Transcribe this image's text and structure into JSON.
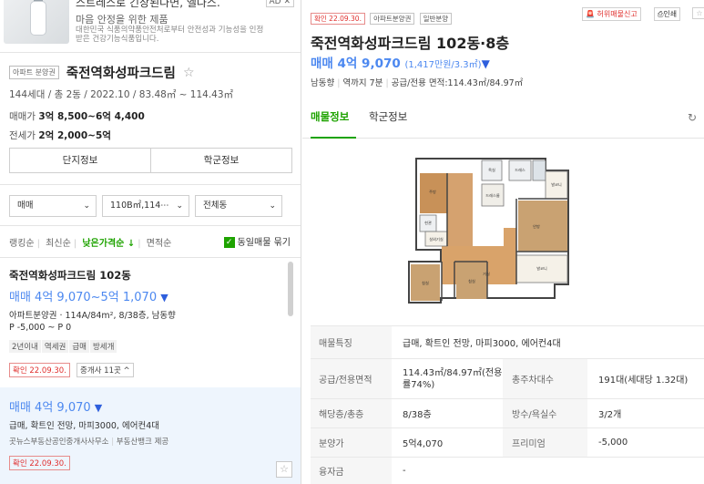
{
  "ad": {
    "title": "스트레스로 긴장된다면, 엘나스.",
    "subtitle": "마음 안정을 위한 제품",
    "desc": "대한민국 식품의약품안전처로부터 안전성과 기능성을 인정받은 건강기능식품입니다.",
    "badge": "AD ✕"
  },
  "complex": {
    "type_chip": "아파트 분양권",
    "name": "죽전역화성파크드림",
    "star": "☆",
    "meta": "144세대 / 총 2동 / 2022.10 / 83.48㎡ ~ 114.43㎡",
    "sale_label": "매매가",
    "sale_value": "3억 8,500~6억 4,400",
    "jeonse_label": "전세가",
    "jeonse_value": "2억 2,000~5억"
  },
  "segments": [
    "단지정보",
    "학군정보"
  ],
  "filters": [
    {
      "label": "매매"
    },
    {
      "label": "110B㎡,114⋯"
    },
    {
      "label": "전체동"
    }
  ],
  "sort": {
    "options": [
      "랭킹순",
      "최신순",
      "낮은가격순 ↓",
      "면적순"
    ],
    "active_index": 2,
    "checkbox_label": "동일매물 묶기",
    "checkbox_checked": true
  },
  "listings": [
    {
      "title": "죽전역화성파크드림 102동",
      "price": "매매 4억 9,070~5억 1,070",
      "line1": "아파트분양권 · 114A/84m², 8/38층, 남동향",
      "line2": "P -5,000 ~ P 0",
      "tags": [
        "2년이내",
        "역세권",
        "급매",
        "방세개"
      ],
      "confirm": "확인 22.09.30.",
      "agents": "중개사 11곳 ^"
    },
    {
      "price": "매매 4억 9,070",
      "desc": "급매, 확트인 전망, 마피3000, 에어컨4대",
      "agent": "곳뉴스부동산공인중개사사무소",
      "provider": "부동산뱅크 제공",
      "confirm": "확인 22.09.30.",
      "star": "☆"
    }
  ],
  "detail": {
    "confirm_chip": "확인 22.09.30.",
    "type_chip": "아파트분양권",
    "kind_chip": "일반분양",
    "report_btn": "허위매물신고",
    "print_btn": "인쇄",
    "title": "죽전역화성파크드림 102동·8층",
    "price": "매매 4억 9,070",
    "price_unit": "(1,417만원/3.3㎡)",
    "info": [
      "남동향",
      "역까지 7분",
      "공급/전용 면적:114.43㎡/84.97㎡"
    ],
    "tabs": [
      "매물정보",
      "학군정보"
    ],
    "active_tab": 0,
    "refresh_icon": "↻"
  },
  "floorplan": {
    "labels": [
      "침실",
      "욕실",
      "드레스룸",
      "발코니",
      "현관",
      "주방",
      "거실",
      "안방",
      "실외기실",
      "침실",
      "침실",
      "발코니",
      "드레스"
    ]
  },
  "table": {
    "rows": [
      {
        "label": "매물특징",
        "value": "급매, 확트인 전망, 마피3000, 에어컨4대"
      },
      {
        "label": "공급/전용면적",
        "value": "114.43㎡/84.97㎡(전용률74%)",
        "label2": "총주차대수",
        "value2": "191대(세대당 1.32대)"
      },
      {
        "label": "해당층/총층",
        "value": "8/38층",
        "label2": "방수/욕실수",
        "value2": "3/2개"
      },
      {
        "label": "분양가",
        "value": "5억4,070",
        "label2": "프리미엄",
        "value2": "-5,000"
      },
      {
        "label": "융자금",
        "value": "-"
      }
    ]
  }
}
